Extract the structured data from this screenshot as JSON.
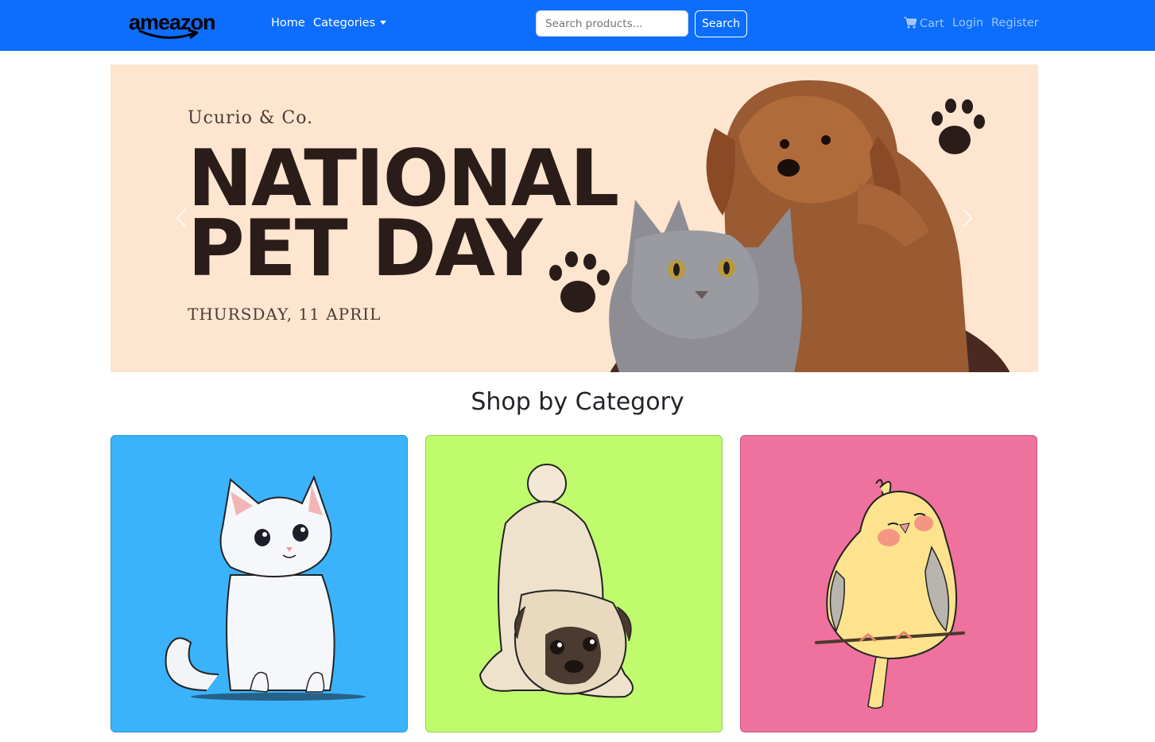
{
  "navbar": {
    "brand": "ameazon",
    "home": "Home",
    "categories": "Categories",
    "search_placeholder": "Search products...",
    "search_button": "Search",
    "cart": "Cart",
    "login": "Login",
    "register": "Register"
  },
  "banner": {
    "brand_line": "Ucurio & Co.",
    "title_line1": "NATIONAL",
    "title_line2": "PET DAY",
    "date_line": "THURSDAY, 11 APRIL"
  },
  "main": {
    "section_title": "Shop by Category"
  },
  "cards": [
    {
      "icon": "cat-illustration",
      "background": "#3ab3fc"
    },
    {
      "icon": "pug-illustration",
      "background": "#c0fb6d"
    },
    {
      "icon": "bird-illustration",
      "background": "#ef719d"
    }
  ],
  "colors": {
    "navbar": "#0d6efd",
    "banner_background": "#fde5d0"
  }
}
